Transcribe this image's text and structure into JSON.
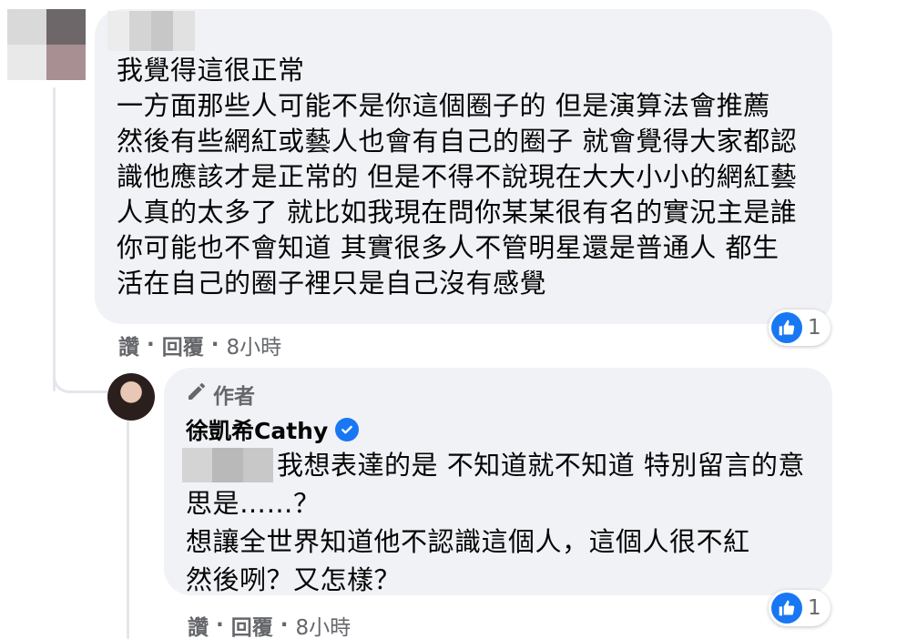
{
  "comment": {
    "text": "我覺得這很正常\n一方面那些人可能不是你這個圈子的 但是演算法會推薦\n然後有些網紅或藝人也會有自己的圈子 就會覺得大家都認\n識他應該才是正常的 但是不得不說現在大大小小的網紅藝\n人真的太多了 就比如我現在問你某某很有名的實況主是誰\n你可能也不會知道 其實很多人不管明星還是普通人 都生\n活在自己的圈子裡只是自己沒有感覺",
    "like_label": "讚",
    "reply_label": "回覆",
    "separator": "·",
    "time": "8小時",
    "reaction_count": "1"
  },
  "reply": {
    "author_badge": "作者",
    "author_name": "徐凱希Cathy",
    "text": "我想表達的是 不知道就不知道 特別留言的意\n思是……？\n想讓全世界知道他不認識這個人，這個人很不紅\n然後咧？又怎樣？",
    "like_label": "讚",
    "reply_label": "回覆",
    "separator": "·",
    "time": "8小時",
    "reaction_count": "1"
  },
  "colors": {
    "bubble": "#f0f2f5",
    "meta": "#65676b",
    "accent": "#1877f2"
  },
  "icons": [
    "like-icon",
    "pencil-icon",
    "verified-icon"
  ]
}
